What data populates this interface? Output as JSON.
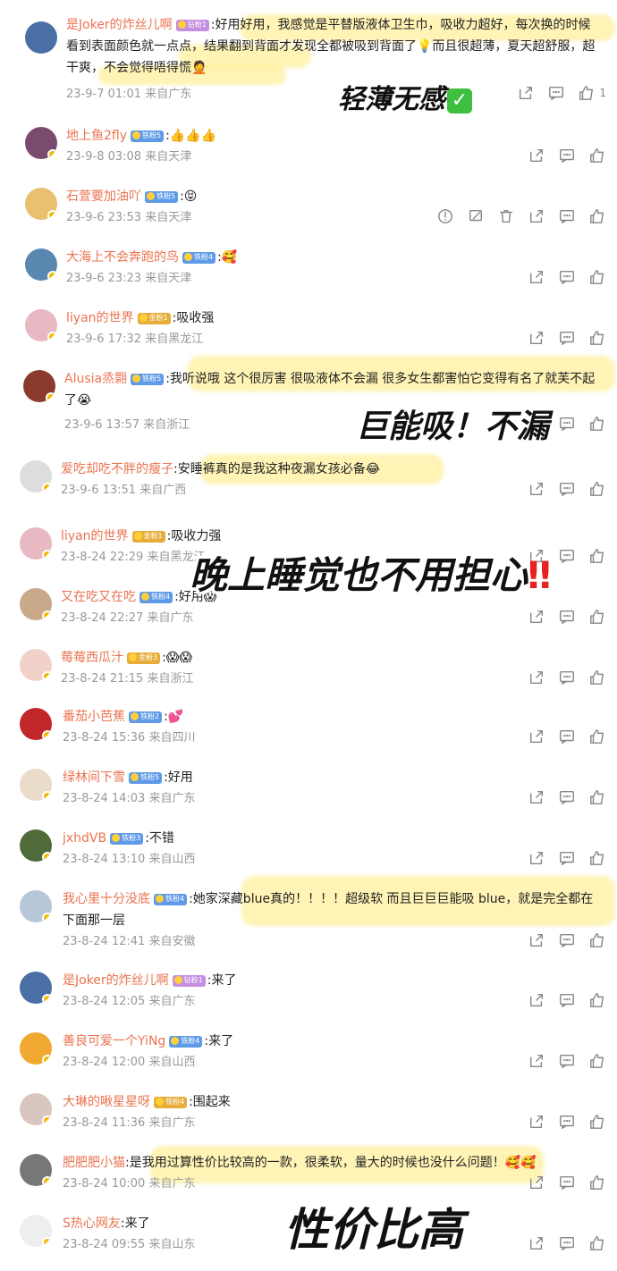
{
  "comments": [
    {
      "user": "是Joker的炸丝儿啊",
      "badge": "钻粉1",
      "badge_type": "diamond",
      "text": ":好用好用，我感觉是平替版液体卫生巾，吸收力超好，每次换的时候",
      "text2": "看到表面颜色就一点点，结果翻到背面才发现全都被吸到背面了💡而且很超薄，夏天超舒服，超",
      "text3": "干爽，不会觉得唔得慌🤦",
      "meta": "23-9-7 01:01 来自广东",
      "likes": "1",
      "avatar_color": "#4a6fa5"
    },
    {
      "user": "地上鱼2fly",
      "badge": "铁粉5",
      "badge_type": "fan",
      "text": ":👍👍👍",
      "meta": "23-9-8 03:08 来自天津",
      "avatar_color": "#7a4b6e"
    },
    {
      "user": "石萱要加油吖",
      "badge": "铁粉5",
      "badge_type": "fan",
      "text": ":😝",
      "meta": "23-9-6 23:53 来自天津",
      "avatar_color": "#e8c070"
    },
    {
      "user": "大海上不会奔跑的鸟",
      "badge": "铁粉4",
      "badge_type": "fan",
      "text": ":🥰",
      "meta": "23-9-6 23:23 来自天津",
      "avatar_color": "#5a87b0"
    },
    {
      "user": "liyan的世界",
      "badge": "金粉1",
      "badge_type": "gold",
      "text": ":吸收强",
      "meta": "23-9-6 17:32 来自黑龙江",
      "avatar_color": "#e8b9c2"
    },
    {
      "user": "Alusia烝翾",
      "badge": "铁粉5",
      "badge_type": "fan",
      "text": ":我听说哦 这个很厉害 很吸液体不会漏 很多女生都害怕它变得有名了就芙不起",
      "text2": "了😭",
      "meta": "23-9-6 13:57 来自浙江",
      "avatar_color": "#8a3b2e"
    },
    {
      "user": "爱吃却吃不胖的瘦子",
      "text": ":安睡裤真的是我这种夜漏女孩必备😂",
      "meta": "23-9-6 13:51 来自广西",
      "avatar_color": "#dddddd"
    },
    {
      "user": "liyan的世界",
      "badge": "金粉1",
      "badge_type": "gold",
      "text": ":吸收力强",
      "meta": "23-8-24 22:29 来自黑龙江",
      "avatar_color": "#e8b9c2"
    },
    {
      "user": "又在吃又在吃",
      "badge": "铁粉4",
      "badge_type": "fan",
      "text": ":好用😱",
      "meta": "23-8-24 22:27 来自广东",
      "avatar_color": "#c9a98a"
    },
    {
      "user": "莓莓西瓜汁",
      "badge": "金粉3",
      "badge_type": "gold",
      "text": ":😱😱",
      "meta": "23-8-24 21:15 来自浙江",
      "avatar_color": "#f2d2c8"
    },
    {
      "user": "番茄小芭蕉",
      "badge": "铁粉2",
      "badge_type": "fan",
      "text": ":💕",
      "meta": "23-8-24 15:36 来自四川",
      "avatar_color": "#c0262a"
    },
    {
      "user": "绿林间下雪",
      "badge": "铁粉5",
      "badge_type": "fan",
      "text": ":好用",
      "meta": "23-8-24 14:03 来自广东",
      "avatar_color": "#eadccb"
    },
    {
      "user": "jxhdVB",
      "badge": "铁粉3",
      "badge_type": "fan",
      "text": ":不错",
      "meta": "23-8-24 13:10 来自山西",
      "avatar_color": "#4f6b3a"
    },
    {
      "user": "我心里十分没底",
      "badge": "铁粉4",
      "badge_type": "fan",
      "text": ":她家深藏blue真的！！！！超级软 而且巨巨巨能吸 blue，就是完全都在",
      "text2": "下面那一层",
      "meta": "23-8-24 12:41 来自安徽",
      "avatar_color": "#b6c8d8"
    },
    {
      "user": "是Joker的炸丝儿啊",
      "badge": "钻粉1",
      "badge_type": "diamond",
      "text": ":来了",
      "meta": "23-8-24 12:05 来自广东",
      "avatar_color": "#4a6fa5"
    },
    {
      "user": "善良可爱一个YiNg",
      "badge": "铁粉4",
      "badge_type": "fan",
      "text": ":来了",
      "meta": "23-8-24 12:00 来自山西",
      "avatar_color": "#f0a830"
    },
    {
      "user": "大琳的啾星星呀",
      "badge": "铁粉4",
      "badge_type": "gold",
      "text": ":围起来",
      "meta": "23-8-24 11:36 来自广东",
      "avatar_color": "#d9c6c0"
    },
    {
      "user": "肥肥肥小猫",
      "text": ":是我用过算性价比较高的一款，很柔软，量大的时候也没什么问题！🥰🥰",
      "meta": "23-8-24 10:00 来自广东",
      "avatar_color": "#777777"
    },
    {
      "user": "S热心网友",
      "text": ":来了",
      "meta": "23-8-24 09:55 来自山东",
      "avatar_color": "#eeeeee"
    }
  ],
  "overlays": {
    "o1": "轻薄无感",
    "o1_check": "✓",
    "o2": "巨能吸！不漏",
    "o3": "晚上睡觉也不用担心",
    "o3_bang": "‼",
    "o4": "性价比高"
  },
  "icons": {
    "share": "share-icon",
    "comment": "comment-icon",
    "like": "like-icon",
    "report": "report-icon",
    "block": "block-icon",
    "delete": "delete-icon"
  }
}
